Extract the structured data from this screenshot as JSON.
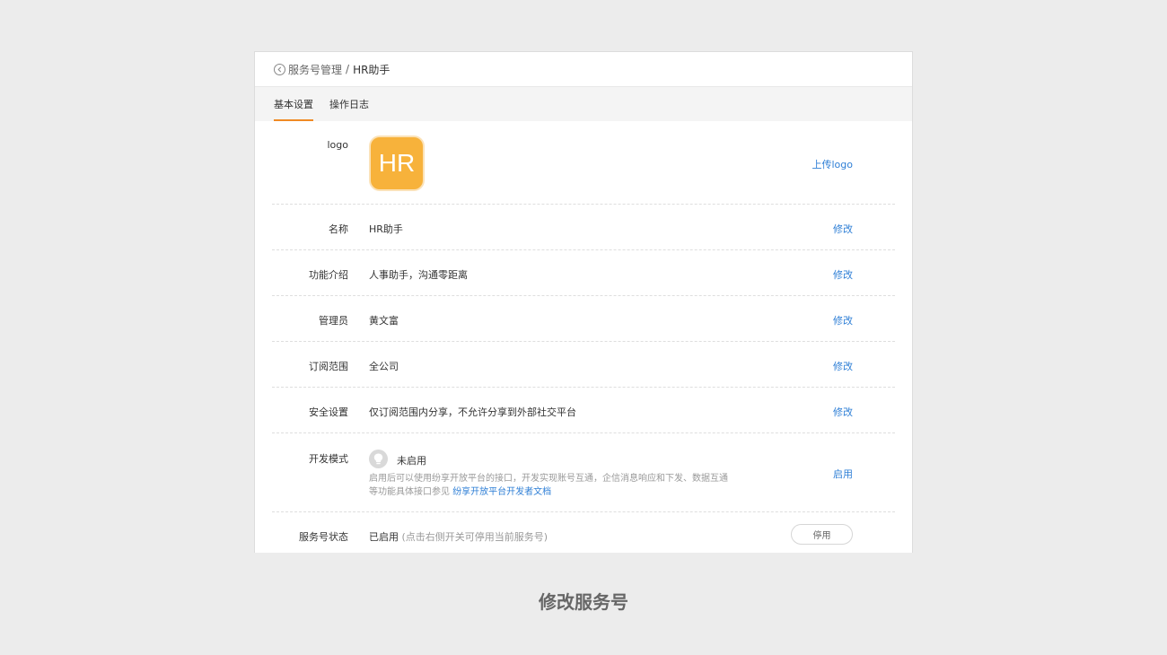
{
  "breadcrumb": {
    "back_icon": "back-circle-icon",
    "parent": "服务号管理",
    "separator": "/",
    "current": "HR助手"
  },
  "tabs": [
    {
      "label": "基本设置",
      "active": true
    },
    {
      "label": "操作日志",
      "active": false
    }
  ],
  "colors": {
    "accent": "#f08a24",
    "link": "#2f7fd6",
    "logo_bg": "#f7b23b"
  },
  "settings": {
    "logo": {
      "label": "logo",
      "logo_text": "HR",
      "action": "上传logo"
    },
    "name": {
      "label": "名称",
      "value": "HR助手",
      "action": "修改"
    },
    "description": {
      "label": "功能介绍",
      "value": "人事助手，沟通零距离",
      "action": "修改"
    },
    "admin": {
      "label": "管理员",
      "value": "黄文富",
      "action": "修改"
    },
    "scope": {
      "label": "订阅范围",
      "value": "全公司",
      "action": "修改"
    },
    "security": {
      "label": "安全设置",
      "value": "仅订阅范围内分享，不允许分享到外部社交平台",
      "action": "修改"
    },
    "dev_mode": {
      "label": "开发模式",
      "icon": "lightbulb-icon",
      "status": "未启用",
      "desc": "启用后可以使用纷享开放平台的接口，开发实现账号互通，企信消息响应和下发、数据互通等功能具体接口参见",
      "link": "纷享开放平台开发者文档",
      "action": "启用"
    },
    "status": {
      "label": "服务号状态",
      "value": "已启用",
      "hint": "(点击右侧开关可停用当前服务号)",
      "button": "停用"
    }
  },
  "caption": "修改服务号"
}
